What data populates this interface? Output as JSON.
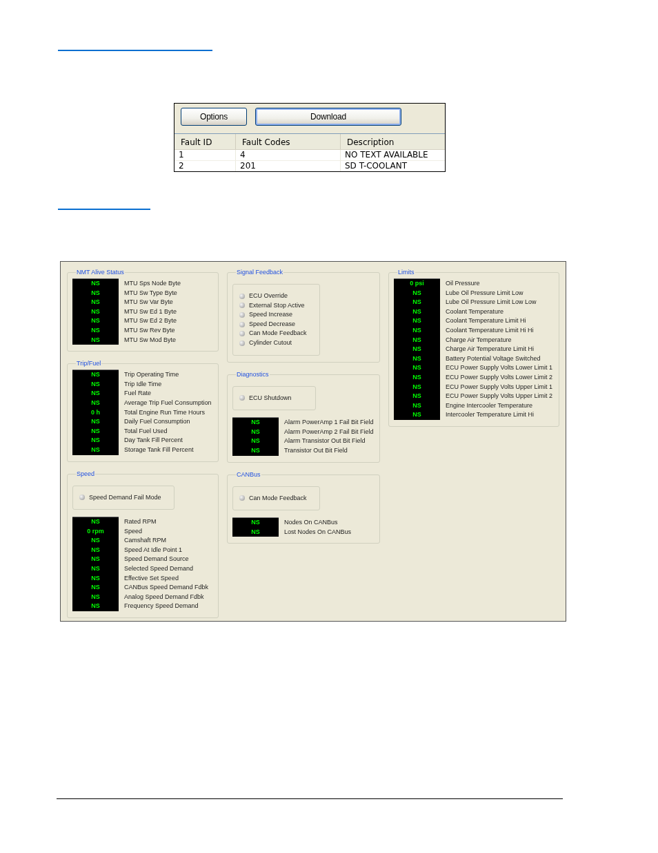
{
  "fault_log": {
    "buttons": [
      {
        "label": "Options",
        "focused": false
      },
      {
        "label": "Download",
        "focused": true
      }
    ],
    "table": {
      "columns": [
        "Fault ID",
        "Fault Codes",
        "Description"
      ],
      "rows": [
        [
          "1",
          "4",
          "NO TEXT AVAILABLE"
        ],
        [
          "2",
          "201",
          "SD T-COOLANT"
        ]
      ]
    }
  },
  "monitor": {
    "columns": [
      {
        "groups": [
          {
            "title": "NMT Alive Status",
            "readings": [
              {
                "value": "NS",
                "label": "MTU Sps Node Byte"
              },
              {
                "value": "NS",
                "label": "MTU Sw Type Byte"
              },
              {
                "value": "NS",
                "label": "MTU Sw Var Byte"
              },
              {
                "value": "NS",
                "label": "MTU Sw Ed 1 Byte"
              },
              {
                "value": "NS",
                "label": "MTU Sw Ed 2 Byte"
              },
              {
                "value": "NS",
                "label": "MTU Sw Rev Byte"
              },
              {
                "value": "NS",
                "label": "MTU Sw Mod Byte"
              }
            ]
          },
          {
            "title": "Trip/Fuel",
            "readings": [
              {
                "value": "NS",
                "label": "Trip Operating Time"
              },
              {
                "value": "NS",
                "label": "Trip Idle Time"
              },
              {
                "value": "NS",
                "label": "Fuel Rate"
              },
              {
                "value": "NS",
                "label": "Average Trip Fuel Consumption"
              },
              {
                "value": "0 h",
                "label": "Total Engine Run Time Hours"
              },
              {
                "value": "NS",
                "label": "Daily Fuel Consumption"
              },
              {
                "value": "NS",
                "label": "Total Fuel Used"
              },
              {
                "value": "NS",
                "label": "Day Tank Fill Percent"
              },
              {
                "value": "NS",
                "label": "Storage Tank Fill Percent"
              }
            ]
          },
          {
            "title": "Speed",
            "indicators": [
              {
                "label": "Speed Demand Fail Mode",
                "on": false
              }
            ],
            "readings": [
              {
                "value": "NS",
                "label": "Rated RPM"
              },
              {
                "value": "0 rpm",
                "label": "Speed"
              },
              {
                "value": "NS",
                "label": "Camshaft RPM"
              },
              {
                "value": "NS",
                "label": "Speed At Idle Point 1"
              },
              {
                "value": "NS",
                "label": "Speed Demand Source"
              },
              {
                "value": "NS",
                "label": "Selected Speed Demand"
              },
              {
                "value": "NS",
                "label": "Effective Set Speed"
              },
              {
                "value": "NS",
                "label": "CANBus Speed Demand Fdbk"
              },
              {
                "value": "NS",
                "label": "Analog Speed Demand Fdbk"
              },
              {
                "value": "NS",
                "label": "Frequency Speed Demand"
              }
            ]
          }
        ]
      },
      {
        "groups": [
          {
            "title": "Signal Feedback",
            "indicators": [
              {
                "label": "ECU Override",
                "on": false
              },
              {
                "label": "External Stop Active",
                "on": false
              },
              {
                "label": "Speed Increase",
                "on": false
              },
              {
                "label": "Speed Decrease",
                "on": false
              },
              {
                "label": "Can Mode Feedback",
                "on": false
              },
              {
                "label": "Cylinder Cutout",
                "on": false
              }
            ]
          },
          {
            "title": "Diagnostics",
            "indicators": [
              {
                "label": "ECU Shutdown",
                "on": false
              }
            ],
            "readings": [
              {
                "value": "NS",
                "label": "Alarm PowerAmp 1 Fail Bit Field"
              },
              {
                "value": "NS",
                "label": "Alarm PowerAmp 2 Fail Bit Field"
              },
              {
                "value": "NS",
                "label": "Alarm Transistor Out Bit Field"
              },
              {
                "value": "NS",
                "label": "Transistor Out Bit Field"
              }
            ]
          },
          {
            "title": "CANBus",
            "indicators": [
              {
                "label": "Can Mode Feedback",
                "on": false
              }
            ],
            "readings": [
              {
                "value": "NS",
                "label": "Nodes On CANBus"
              },
              {
                "value": "NS",
                "label": "Lost Nodes On CANBus"
              }
            ]
          }
        ]
      },
      {
        "groups": [
          {
            "title": "Limits",
            "readings": [
              {
                "value": "0 psi",
                "label": "Oil Pressure"
              },
              {
                "value": "NS",
                "label": "Lube Oil Pressure Limit Low"
              },
              {
                "value": "NS",
                "label": "Lube Oil Pressure Limit Low Low"
              },
              {
                "value": "NS",
                "label": "Coolant Temperature"
              },
              {
                "value": "NS",
                "label": "Coolant Temperature Limit Hi"
              },
              {
                "value": "NS",
                "label": "Coolant Temperature Limit Hi Hi"
              },
              {
                "value": "NS",
                "label": "Charge Air Temperature"
              },
              {
                "value": "NS",
                "label": "Charge Air Temperature Limit Hi"
              },
              {
                "value": "NS",
                "label": "Battery Potential Voltage Switched"
              },
              {
                "value": "NS",
                "label": "ECU Power Supply Volts Lower Limit 1"
              },
              {
                "value": "NS",
                "label": "ECU Power Supply Volts Lower Limit 2"
              },
              {
                "value": "NS",
                "label": "ECU Power Supply Volts Upper Limit 1"
              },
              {
                "value": "NS",
                "label": "ECU Power Supply Volts Upper Limit 2"
              },
              {
                "value": "NS",
                "label": "Engine Intercooler Temperature"
              },
              {
                "value": "NS",
                "label": "Intercooler Temperature Limit Hi"
              }
            ]
          }
        ]
      }
    ]
  }
}
